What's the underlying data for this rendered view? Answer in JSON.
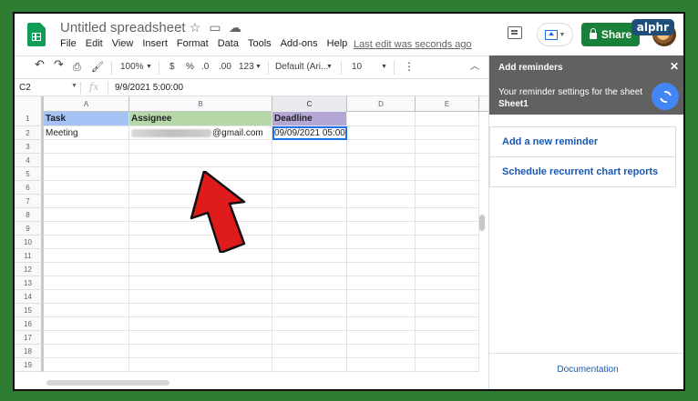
{
  "brand": "alphr",
  "app": {
    "title": "Untitled spreadsheet",
    "menu": [
      "File",
      "Edit",
      "View",
      "Insert",
      "Format",
      "Data",
      "Tools",
      "Add-ons",
      "Help"
    ],
    "last_edit": "Last edit was seconds ago",
    "share_label": "Share"
  },
  "toolbar": {
    "zoom": "100%",
    "currency": "$",
    "percent": "%",
    "decrease_decimal": ".0",
    "increase_decimal": ".00",
    "more_formats": "123",
    "font": "Default (Ari...",
    "font_size": "10",
    "more": "⋮"
  },
  "formula_bar": {
    "cell_ref": "C2",
    "fx": "fx",
    "value": "9/9/2021 5:00:00"
  },
  "grid": {
    "columns": [
      "A",
      "B",
      "C",
      "D",
      "E"
    ],
    "selected_column": "C",
    "row_numbers": [
      "1",
      "2",
      "3",
      "4",
      "5",
      "6",
      "7",
      "8",
      "9",
      "10",
      "11",
      "12",
      "13",
      "14",
      "15",
      "16",
      "17",
      "18",
      "19"
    ],
    "header_row": [
      "Task",
      "Assignee",
      "Deadline"
    ],
    "header_colors": [
      "#a4c2f4",
      "#b6d7a8",
      "#b4a7d6"
    ],
    "data_row": {
      "task": "Meeting",
      "assignee_suffix": "@gmail.com",
      "deadline": "09/09/2021 05:00"
    }
  },
  "sidebar": {
    "title": "Add reminders",
    "close": "✕",
    "description": "Your reminder settings for the sheet",
    "sheet_name": "Sheet1",
    "links": [
      "Add a new reminder",
      "Schedule recurrent chart reports"
    ],
    "documentation": "Documentation"
  },
  "colors": {
    "accent": "#1a73e8",
    "share_green": "#188038",
    "sidebar_header": "#616161",
    "arrow_red": "#e01b1b"
  }
}
